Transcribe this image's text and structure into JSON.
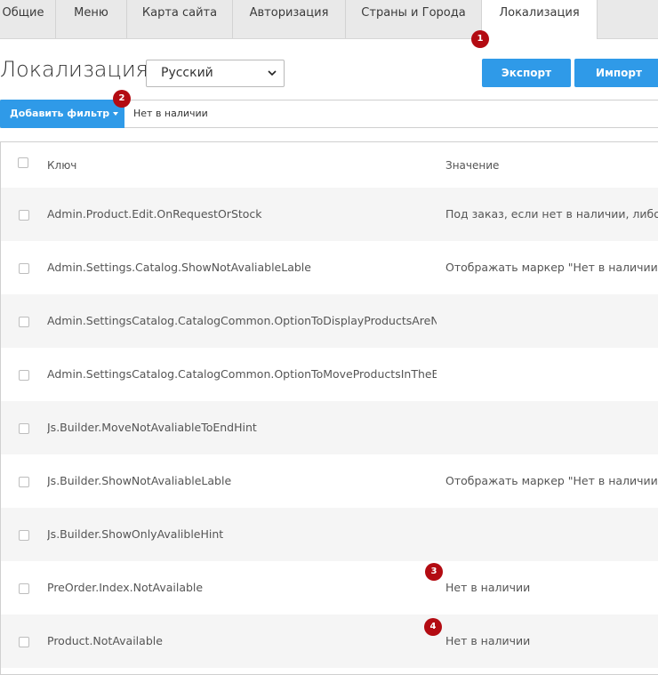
{
  "tabs": [
    {
      "label": "Общие",
      "active": false
    },
    {
      "label": "Меню",
      "active": false
    },
    {
      "label": "Карта сайта",
      "active": false
    },
    {
      "label": "Авторизация",
      "active": false
    },
    {
      "label": "Страны и Города",
      "active": false
    },
    {
      "label": "Локализация",
      "active": true
    }
  ],
  "page_title": "Локализация",
  "language_select": {
    "selected": "Русский"
  },
  "buttons": {
    "export": "Экспорт",
    "import": "Импорт"
  },
  "filter": {
    "add_label": "Добавить фильтр",
    "value": "Нет в наличии"
  },
  "table": {
    "columns": {
      "key": "Ключ",
      "value": "Значение"
    },
    "rows": [
      {
        "key": "Admin.Product.Edit.OnRequestOrStock",
        "value": "Под заказ, если нет в наличии, либо н"
      },
      {
        "key": "Admin.Settings.Catalog.ShowNotAvaliableLable",
        "value": "Отображать маркер \"Нет в наличии\""
      },
      {
        "key": "Admin.SettingsCatalog.CatalogCommon.OptionToDisplayProductsAreNo",
        "value": ""
      },
      {
        "key": "Admin.SettingsCatalog.CatalogCommon.OptionToMoveProductsInTheEn",
        "value": ""
      },
      {
        "key": "Js.Builder.MoveNotAvaliableToEndHint",
        "value": ""
      },
      {
        "key": "Js.Builder.ShowNotAvaliableLable",
        "value": "Отображать маркер \"Нет в наличии\""
      },
      {
        "key": "Js.Builder.ShowOnlyAvalibleHint",
        "value": ""
      },
      {
        "key": "PreOrder.Index.NotAvailable",
        "value": "Нет в наличии"
      },
      {
        "key": "Product.NotAvailable",
        "value": "Нет в наличии"
      }
    ]
  },
  "markers": [
    "1",
    "2",
    "3",
    "4"
  ],
  "colors": {
    "primary": "#2f9ae8",
    "marker": "#b30b12",
    "tabbar": "#e9e9e9",
    "row_alt": "#f5f5f5"
  }
}
